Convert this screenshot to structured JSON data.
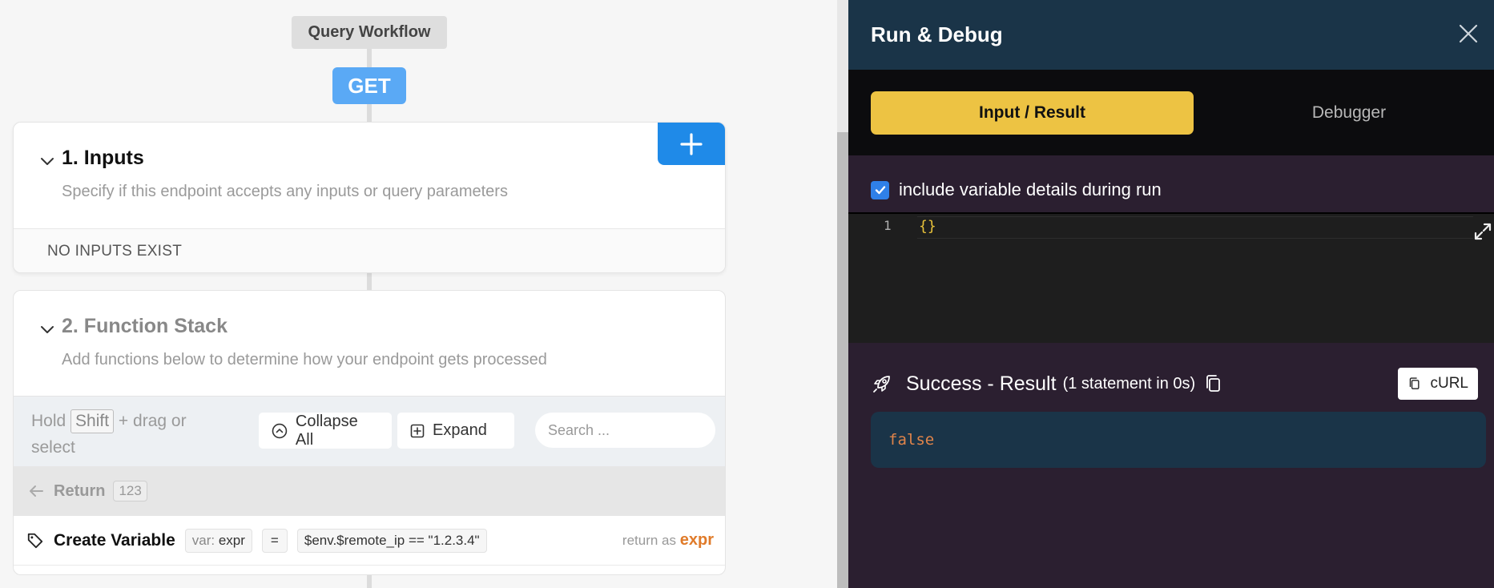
{
  "workflow": {
    "label": "Query Workflow",
    "method": "GET"
  },
  "inputs": {
    "title": "1. Inputs",
    "subtitle": "Specify if this endpoint accepts any inputs or query parameters",
    "empty_text": "NO INPUTS EXIST"
  },
  "function_stack": {
    "title": "2. Function Stack",
    "subtitle": "Add functions below to determine how your endpoint gets processed",
    "hint_prefix": "Hold",
    "hint_key": "Shift",
    "hint_suffix": "+ drag or select",
    "collapse_label": "Collapse All",
    "expand_label": "Expand",
    "search_placeholder": "Search ...",
    "return_label": "Return",
    "return_badge": "123",
    "create_variable": {
      "title": "Create Variable",
      "var_prefix": "var:",
      "var_name": "expr",
      "operator": "=",
      "expression": "$env.$remote_ip == \"1.2.3.4\"",
      "return_as_prefix": "return as",
      "return_as_value": "expr"
    }
  },
  "panel": {
    "title": "Run & Debug",
    "tabs": [
      {
        "label": "Input / Result"
      },
      {
        "label": "Debugger"
      }
    ],
    "include_vars_label": "include variable details during run",
    "editor": {
      "line_number": "1",
      "content": "{}"
    },
    "result": {
      "title": "Success - Result",
      "meta": "(1 statement in 0s)",
      "curl_label": "cURL",
      "value": "false"
    }
  },
  "colors": {
    "accent_blue": "#1f8ae8",
    "get_badge": "#5aa9f5",
    "active_tab": "#edc343",
    "panel_header": "#1a3448",
    "panel_bg": "#2b1f30",
    "result_value": "#e0844a",
    "return_as_value": "#e07b2a"
  }
}
